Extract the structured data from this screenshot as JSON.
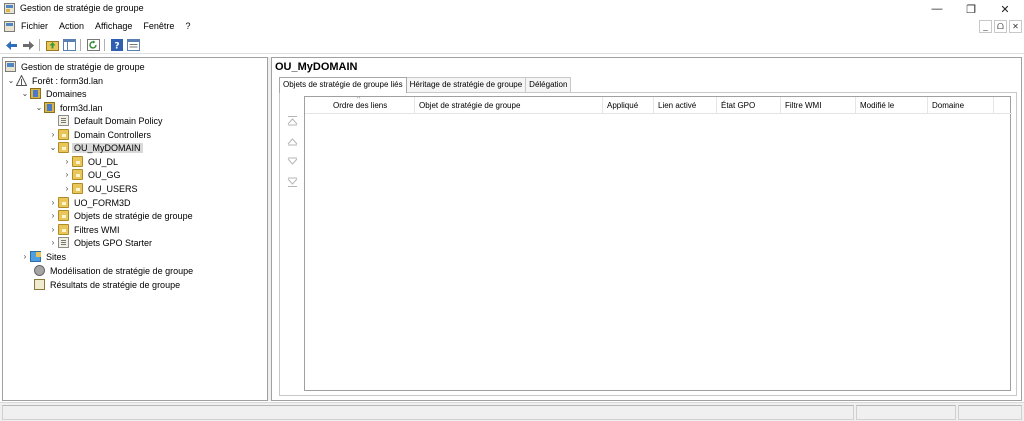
{
  "window": {
    "title": "Gestion de stratégie de groupe",
    "icon": "gpmc-app-icon",
    "controls": {
      "minimize": "—",
      "maximize": "❐",
      "close": "✕"
    }
  },
  "menubar": {
    "items": [
      "Fichier",
      "Action",
      "Affichage",
      "Fenêtre",
      "?"
    ],
    "mdi_controls": {
      "minimize": "_",
      "restore": "ᗝ",
      "close": "✕"
    }
  },
  "toolbar": {
    "buttons": [
      "back-icon",
      "forward-icon",
      "up-folder-icon",
      "show-hide-tree-icon",
      "refresh-icon",
      "help-icon",
      "properties-icon"
    ]
  },
  "tree": {
    "root": "Gestion de stratégie de groupe",
    "forest": "Forêt : form3d.lan",
    "domains": "Domaines",
    "domain": "form3d.lan",
    "default_policy": "Default Domain Policy",
    "domain_controllers": "Domain Controllers",
    "selected_ou": "OU_MyDOMAIN",
    "child_ous": [
      "OU_DL",
      "OU_GG",
      "OU_USERS"
    ],
    "uo_form3d": "UO_FORM3D",
    "gpo_objects": "Objets de stratégie de groupe",
    "wmi_filters": "Filtres WMI",
    "starter_gpos": "Objets GPO Starter",
    "sites": "Sites",
    "modeling": "Modélisation de stratégie de groupe",
    "results": "Résultats de stratégie de groupe"
  },
  "detail": {
    "title": "OU_MyDOMAIN",
    "tabs": [
      {
        "label": "Objets de stratégie de groupe liés",
        "active": true
      },
      {
        "label": "Héritage de stratégie de groupe",
        "active": false
      },
      {
        "label": "Délégation",
        "active": false
      }
    ],
    "columns": [
      "Ordre des liens",
      "Objet de stratégie de groupe",
      "Appliqué",
      "Lien activé",
      "État GPO",
      "Filtre WMI",
      "Modifié le",
      "Domaine"
    ],
    "rows": []
  },
  "colors": {
    "selection": "#d9d9d9",
    "folder": "#e8c65a",
    "back_arrow": "#2f6fb7",
    "forward_arrow": "#6b6b6b",
    "disabled": "#b5b5b5"
  }
}
